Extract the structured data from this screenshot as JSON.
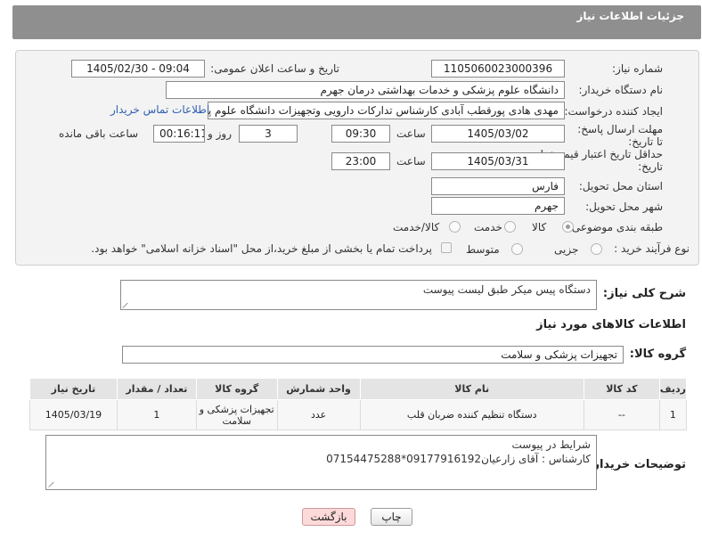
{
  "header": {
    "title": "جزئیات اطلاعات نیاز"
  },
  "fields": {
    "need_number": {
      "label": "شماره نیاز:",
      "value": "1105060023000396"
    },
    "announce": {
      "label": "تاریخ و ساعت اعلان عمومی:",
      "value": "1405/02/30 - 09:04"
    },
    "buyer_org": {
      "label": "نام دستگاه خریدار:",
      "value": "دانشگاه علوم پزشکی و خدمات بهداشتی  درمان جهرم"
    },
    "requester": {
      "label": "ایجاد کننده درخواست:",
      "value": "مهدی هادی پورقطب آبادی کارشناس تدارکات دارویی وتجهیزات دانشگاه علوم پز",
      "contact_link": "اطلاعات تماس خریدار"
    },
    "deadline": {
      "label": "مهلت ارسال پاسخ: تا تاریخ:",
      "date": "1405/03/02",
      "time_label": "ساعت",
      "time": "09:30",
      "days": "3",
      "days_label": "روز و",
      "remaining": "00:16:11",
      "remaining_label": "ساعت باقی مانده"
    },
    "price_validity": {
      "label": "حداقل تاریخ اعتبار قیمت: تا تاریخ:",
      "date": "1405/03/31",
      "time_label": "ساعت",
      "time": "23:00"
    },
    "province": {
      "label": "استان محل تحویل:",
      "value": "فارس"
    },
    "city": {
      "label": "شهر محل تحویل:",
      "value": "جهرم"
    },
    "category": {
      "label": "طبقه بندی موضوعی:",
      "options": [
        "کالا",
        "خدمت",
        "کالا/خدمت"
      ],
      "selected": "کالا"
    },
    "process": {
      "label": "نوع فرآیند خرید :",
      "options": [
        "جزیی",
        "متوسط"
      ],
      "selected": "جزیی",
      "payment_note": "پرداخت تمام یا بخشی از مبلغ خرید،از محل \"اسناد خزانه اسلامی\" خواهد بود."
    }
  },
  "summary": {
    "label": "شرح کلی نیاز:",
    "value": "دستگاه پیس میکر طبق لیست پیوست"
  },
  "goods_section": {
    "title": "اطلاعات کالاهای مورد نیاز"
  },
  "goods_group": {
    "label": "گروه کالا:",
    "value": "تجهیزات پزشکی و سلامت"
  },
  "table": {
    "headers": [
      "ردیف",
      "کد کالا",
      "نام کالا",
      "واحد شمارش",
      "گروه کالا",
      "تعداد / مقدار",
      "تاریخ نیاز"
    ],
    "rows": [
      [
        "1",
        "--",
        "دستگاه تنظیم کننده ضربان قلب",
        "عدد",
        "تجهیزات پزشکی و سلامت",
        "1",
        "1405/03/19"
      ]
    ]
  },
  "buyer_notes": {
    "label": "توضیحات خریدار:",
    "line1": "شرایط در پیوست",
    "line2": "کارشناس : آقای زارعیان09177916192*07154475288"
  },
  "buttons": {
    "print": "چاپ",
    "back": "بازگشت"
  }
}
